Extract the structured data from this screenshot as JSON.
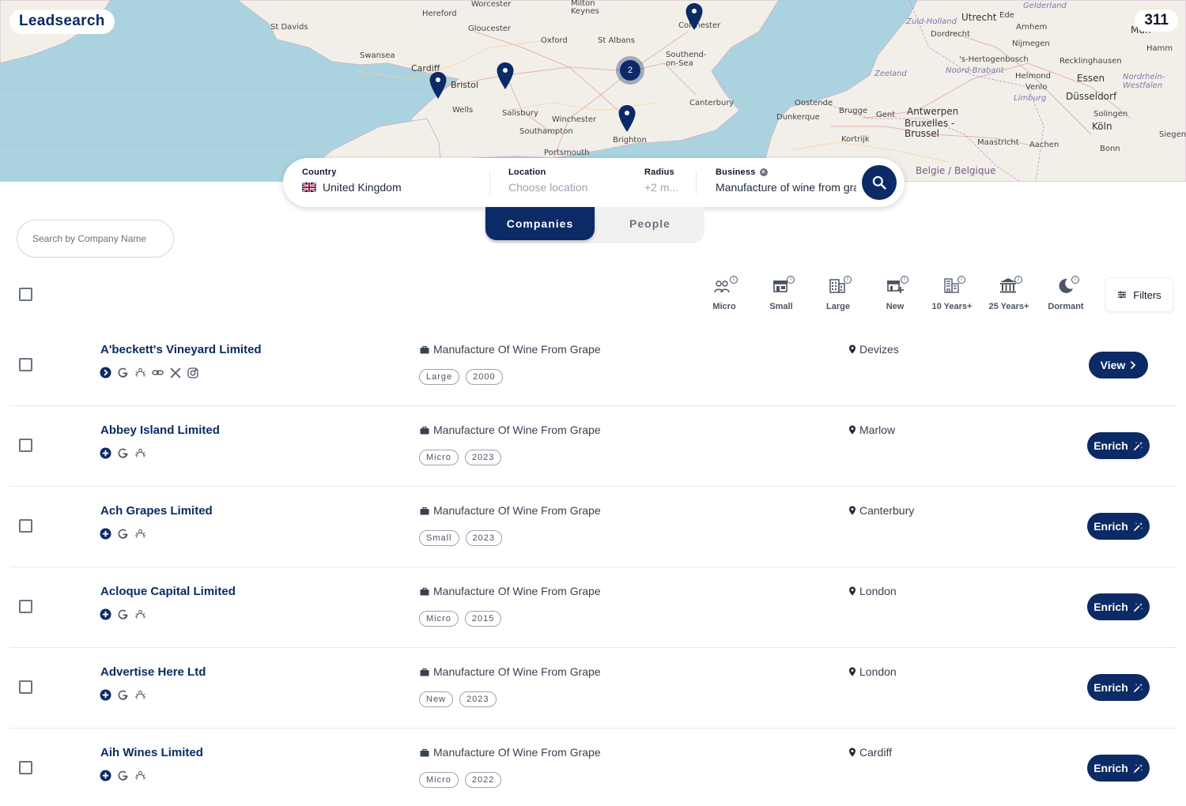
{
  "app": {
    "brand": "Leadsearch",
    "result_count": "311"
  },
  "map": {
    "labels": {
      "hereford": "Hereford",
      "worcester": "Worcester",
      "milton_keynes": "Milton Keynes",
      "st_davids": "St Davids",
      "gloucester": "Gloucester",
      "oxford": "Oxford",
      "st_albans": "St Albans",
      "swansea": "Swansea",
      "cardiff": "Cardiff",
      "bristol": "Bristol",
      "wells": "Wells",
      "salisbury": "Salisbury",
      "winchester": "Winchester",
      "southampton": "Southampton",
      "portsmouth": "Portsmouth",
      "brighton": "Brighton",
      "southend": "Southend-on-Sea",
      "canterbury": "Canterbury",
      "colchester": "Colchester",
      "ostende": "Oostende",
      "dunkerque": "Dunkerque",
      "brugge": "Brugge",
      "gent": "Gent",
      "kortrijk": "Kortrijk",
      "antwerpen": "Antwerpen",
      "bruxelles": "Bruxelles - Brussel",
      "zeeland": "Zeeland",
      "zuid_holland": "Zuid-Holland",
      "utrecht": "Utrecht",
      "dordrecht": "Dordrecht",
      "gelderland": "Gelderland",
      "arnhem": "Arnhem",
      "nijmegen": "Nijmegen",
      "hertogenbosch": "'s-Hertogenbosch",
      "noord_brabant": "Noord-Brabant",
      "helmond": "Helmond",
      "venlo": "Venlo",
      "limburg": "Limburg",
      "recklinghausen": "Recklinghausen",
      "essen": "Essen",
      "dusseldorf": "Düsseldorf",
      "nordrhein": "Nordrhein-Westfalen",
      "solingen": "Solingen",
      "koln": "Köln",
      "maastricht": "Maastricht",
      "aachen": "Aachen",
      "bonn": "Bonn",
      "siegen": "Siegen",
      "hamm": "Hamm",
      "ede": "Ede",
      "belgique": "Belgie / Belgique",
      "munster": "Mün"
    },
    "cluster_count": "2"
  },
  "searchbar": {
    "country_label": "Country",
    "country_value": "United Kingdom",
    "location_label": "Location",
    "location_placeholder": "Choose location",
    "radius_label": "Radius",
    "radius_placeholder": "+2 m...",
    "business_label": "Business",
    "business_value": "Manufacture of wine from grape"
  },
  "tabs": [
    {
      "label": "Companies",
      "active": true
    },
    {
      "label": "People",
      "active": false
    }
  ],
  "company_search": {
    "placeholder": "Search by Company Name"
  },
  "size_filters": [
    {
      "label": "Micro",
      "icon": "people-icon"
    },
    {
      "label": "Small",
      "icon": "shop-icon"
    },
    {
      "label": "Large",
      "icon": "building-icon"
    },
    {
      "label": "New",
      "icon": "new-shop-icon"
    },
    {
      "label": "10 Years+",
      "icon": "office-icon"
    },
    {
      "label": "25 Years+",
      "icon": "bank-icon"
    },
    {
      "label": "Dormant",
      "icon": "moon-icon"
    }
  ],
  "filters_button": {
    "label": "Filters"
  },
  "companies": [
    {
      "name": "A'beckett's Vineyard Limited",
      "industry": "Manufacture Of Wine From Grape",
      "size": "Large",
      "year": "2000",
      "location": "Devizes",
      "action": "View",
      "verified": true,
      "extra_socials": true
    },
    {
      "name": "Abbey Island Limited",
      "industry": "Manufacture Of Wine From Grape",
      "size": "Micro",
      "year": "2023",
      "location": "Marlow",
      "action": "Enrich"
    },
    {
      "name": "Ach Grapes Limited",
      "industry": "Manufacture Of Wine From Grape",
      "size": "Small",
      "year": "2023",
      "location": "Canterbury",
      "action": "Enrich"
    },
    {
      "name": "Acloque Capital Limited",
      "industry": "Manufacture Of Wine From Grape",
      "size": "Micro",
      "year": "2015",
      "location": "London",
      "action": "Enrich"
    },
    {
      "name": "Advertise Here Ltd",
      "industry": "Manufacture Of Wine From Grape",
      "size": "New",
      "year": "2023",
      "location": "London",
      "action": "Enrich"
    },
    {
      "name": "Aih Wines Limited",
      "industry": "Manufacture Of Wine From Grape",
      "size": "Micro",
      "year": "2022",
      "location": "Cardiff",
      "action": "Enrich"
    }
  ],
  "colors": {
    "primary": "#0b2a66",
    "sea": "#aad3df",
    "land": "#f2efe9"
  }
}
